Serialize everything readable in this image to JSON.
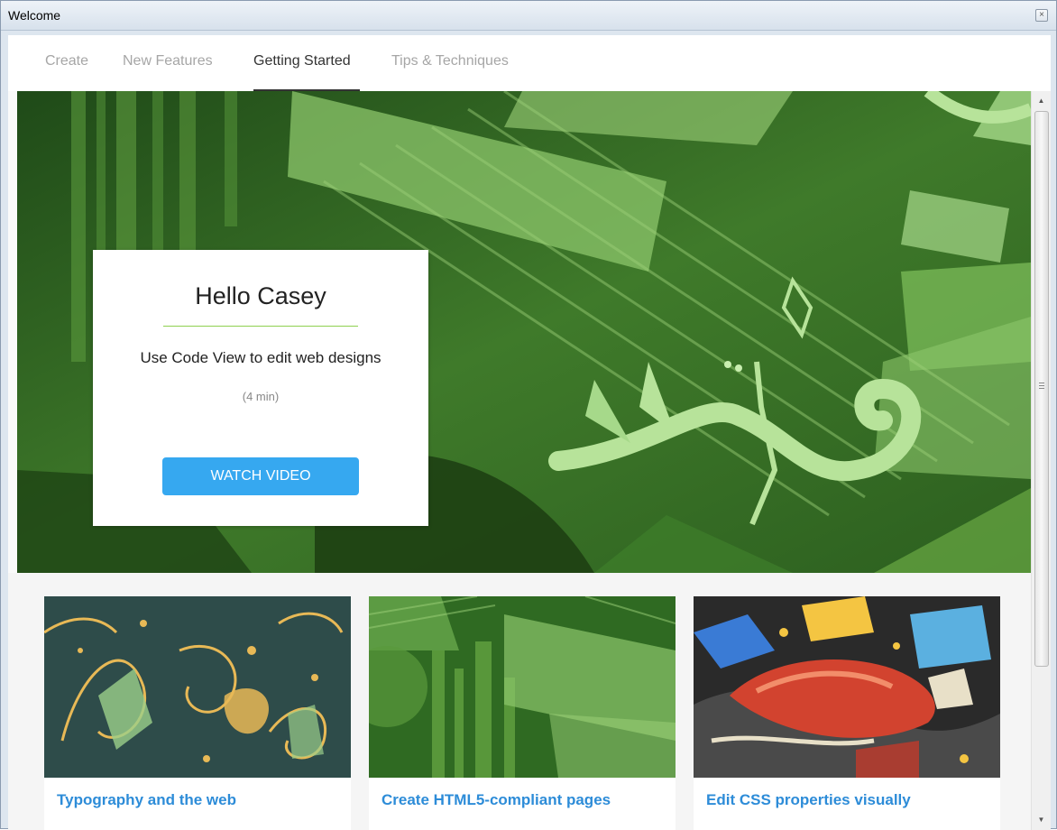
{
  "window": {
    "title": "Welcome",
    "close_glyph": "×"
  },
  "tabs": [
    {
      "label": "Create",
      "active": false
    },
    {
      "label": "New Features",
      "active": false
    },
    {
      "label": "Getting Started",
      "active": true
    },
    {
      "label": "Tips & Techniques",
      "active": false
    }
  ],
  "hero": {
    "greeting": "Hello Casey",
    "subtitle": "Use Code View to edit web designs",
    "duration": "(4 min)",
    "button_label": "WATCH VIDEO"
  },
  "thumbnails": [
    {
      "title": "Typography and the web",
      "image": "typography-illustration"
    },
    {
      "title": "Create HTML5-compliant pages",
      "image": "green-code-illustration"
    },
    {
      "title": "Edit CSS properties visually",
      "image": "colorful-collage-illustration"
    }
  ],
  "colors": {
    "accent_green": "#8fd14f",
    "button_blue": "#36a8f0",
    "link_blue": "#2d8cd8"
  },
  "icons": {
    "close": "close-icon",
    "scroll_up": "scroll-up-arrow-icon",
    "scroll_down": "scroll-down-arrow-icon"
  }
}
